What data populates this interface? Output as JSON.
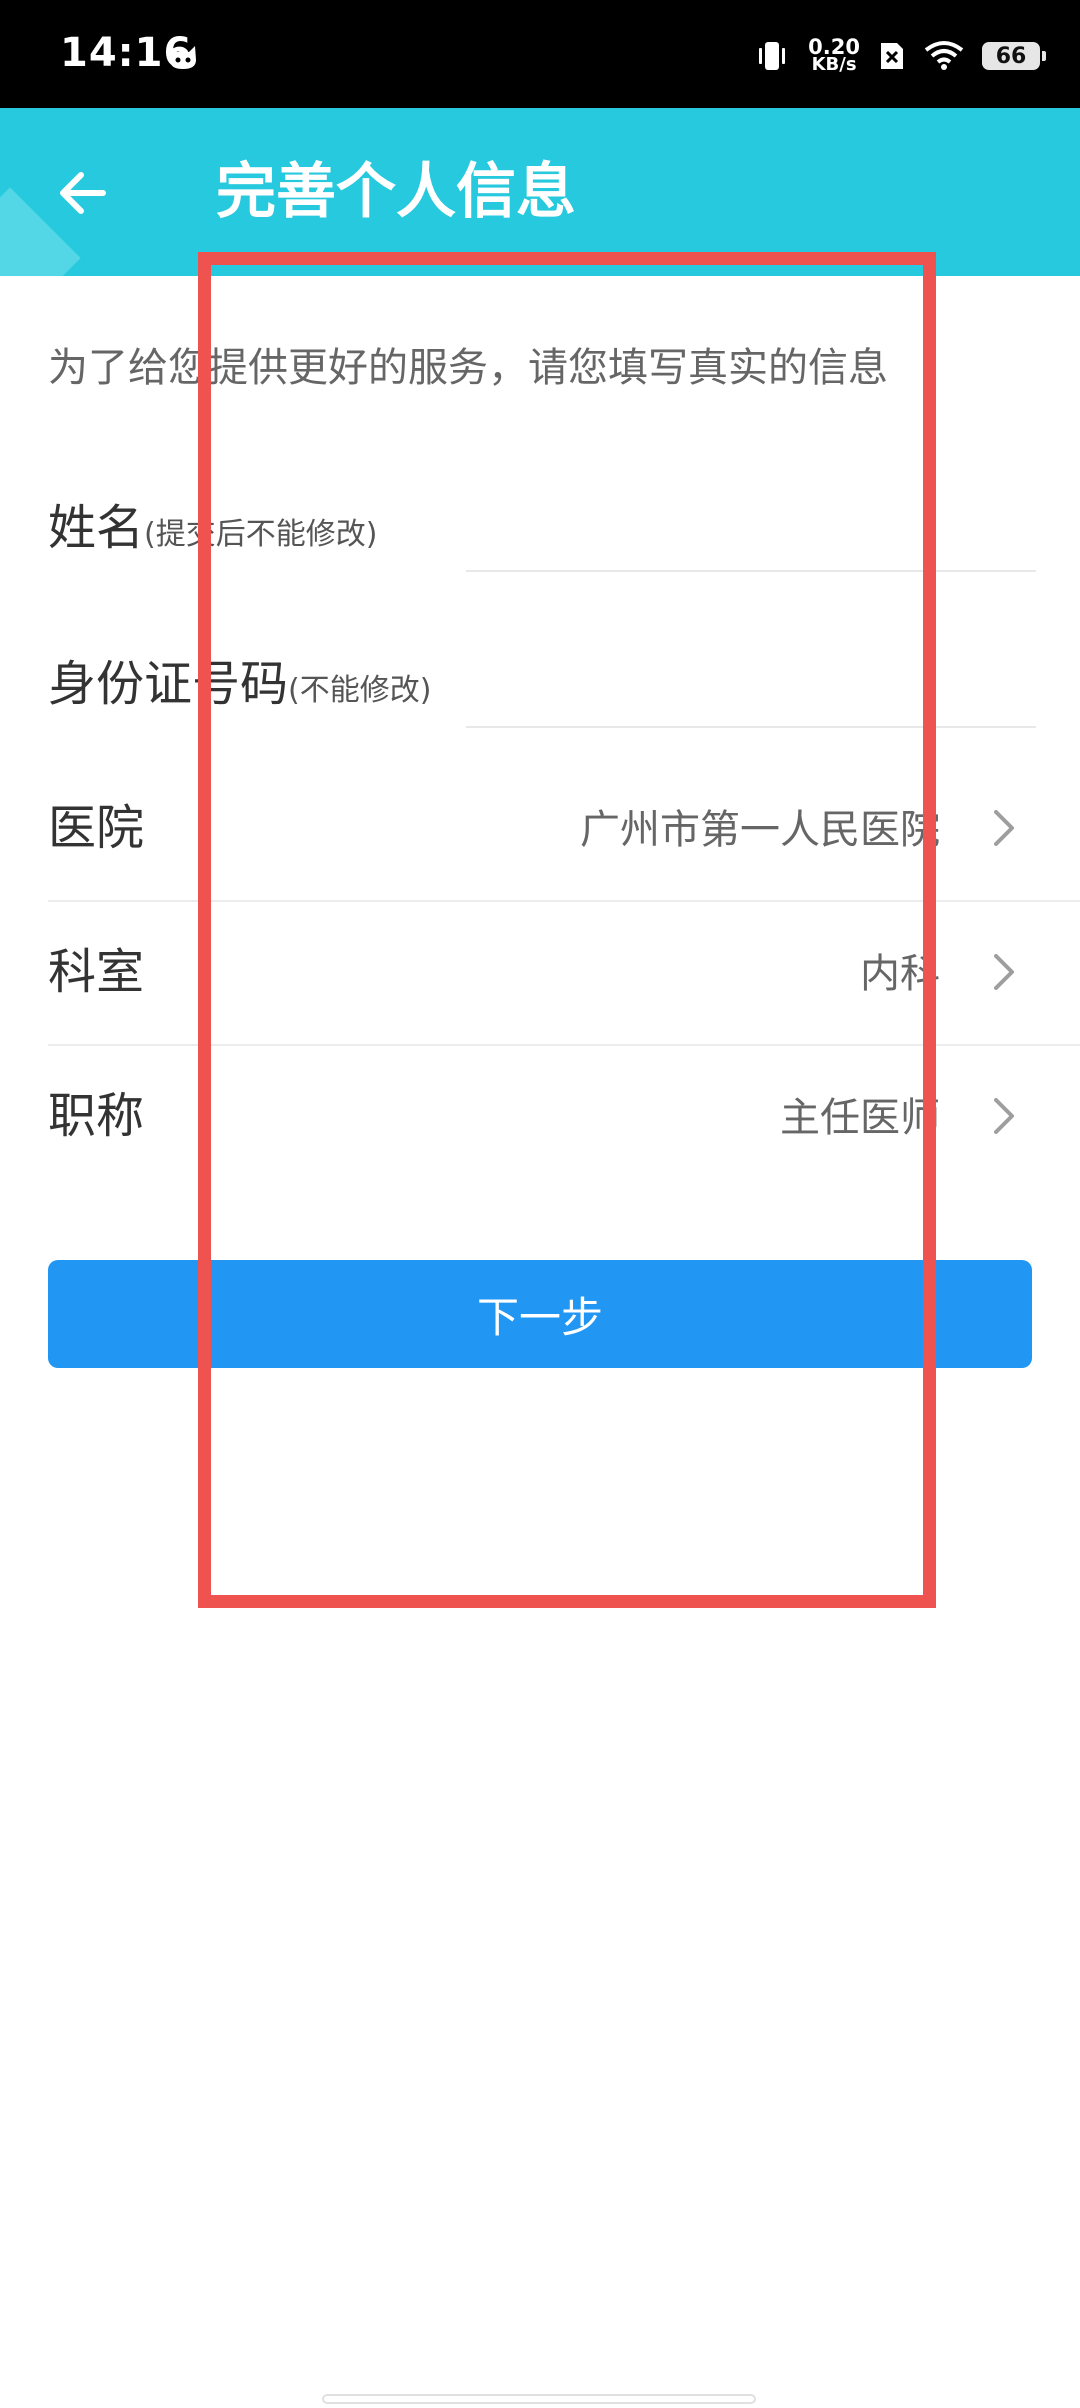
{
  "status_bar": {
    "time": "14:16",
    "net_speed_value": "0.20",
    "net_speed_unit": "KB/s",
    "battery": "66"
  },
  "header": {
    "title": "完善个人信息"
  },
  "intro": "为了给您提供更好的服务，请您填写真实的信息",
  "form": {
    "name_label": "姓名",
    "name_hint": "(提交后不能修改)",
    "name_value": "",
    "id_label": "身份证号码",
    "id_hint": "(不能修改)",
    "id_value": ""
  },
  "selects": {
    "hospital_label": "医院",
    "hospital_value": "广州市第一人民医院",
    "department_label": "科室",
    "department_value": "内科",
    "title_label": "职称",
    "title_value": "主任医师"
  },
  "next_button": "下一步",
  "colors": {
    "header_bg": "#26c9dd",
    "button_bg": "#2196f3",
    "highlight": "#ef5350"
  },
  "icons": {
    "back": "arrow-left-icon",
    "chevron": "chevron-right-icon"
  }
}
